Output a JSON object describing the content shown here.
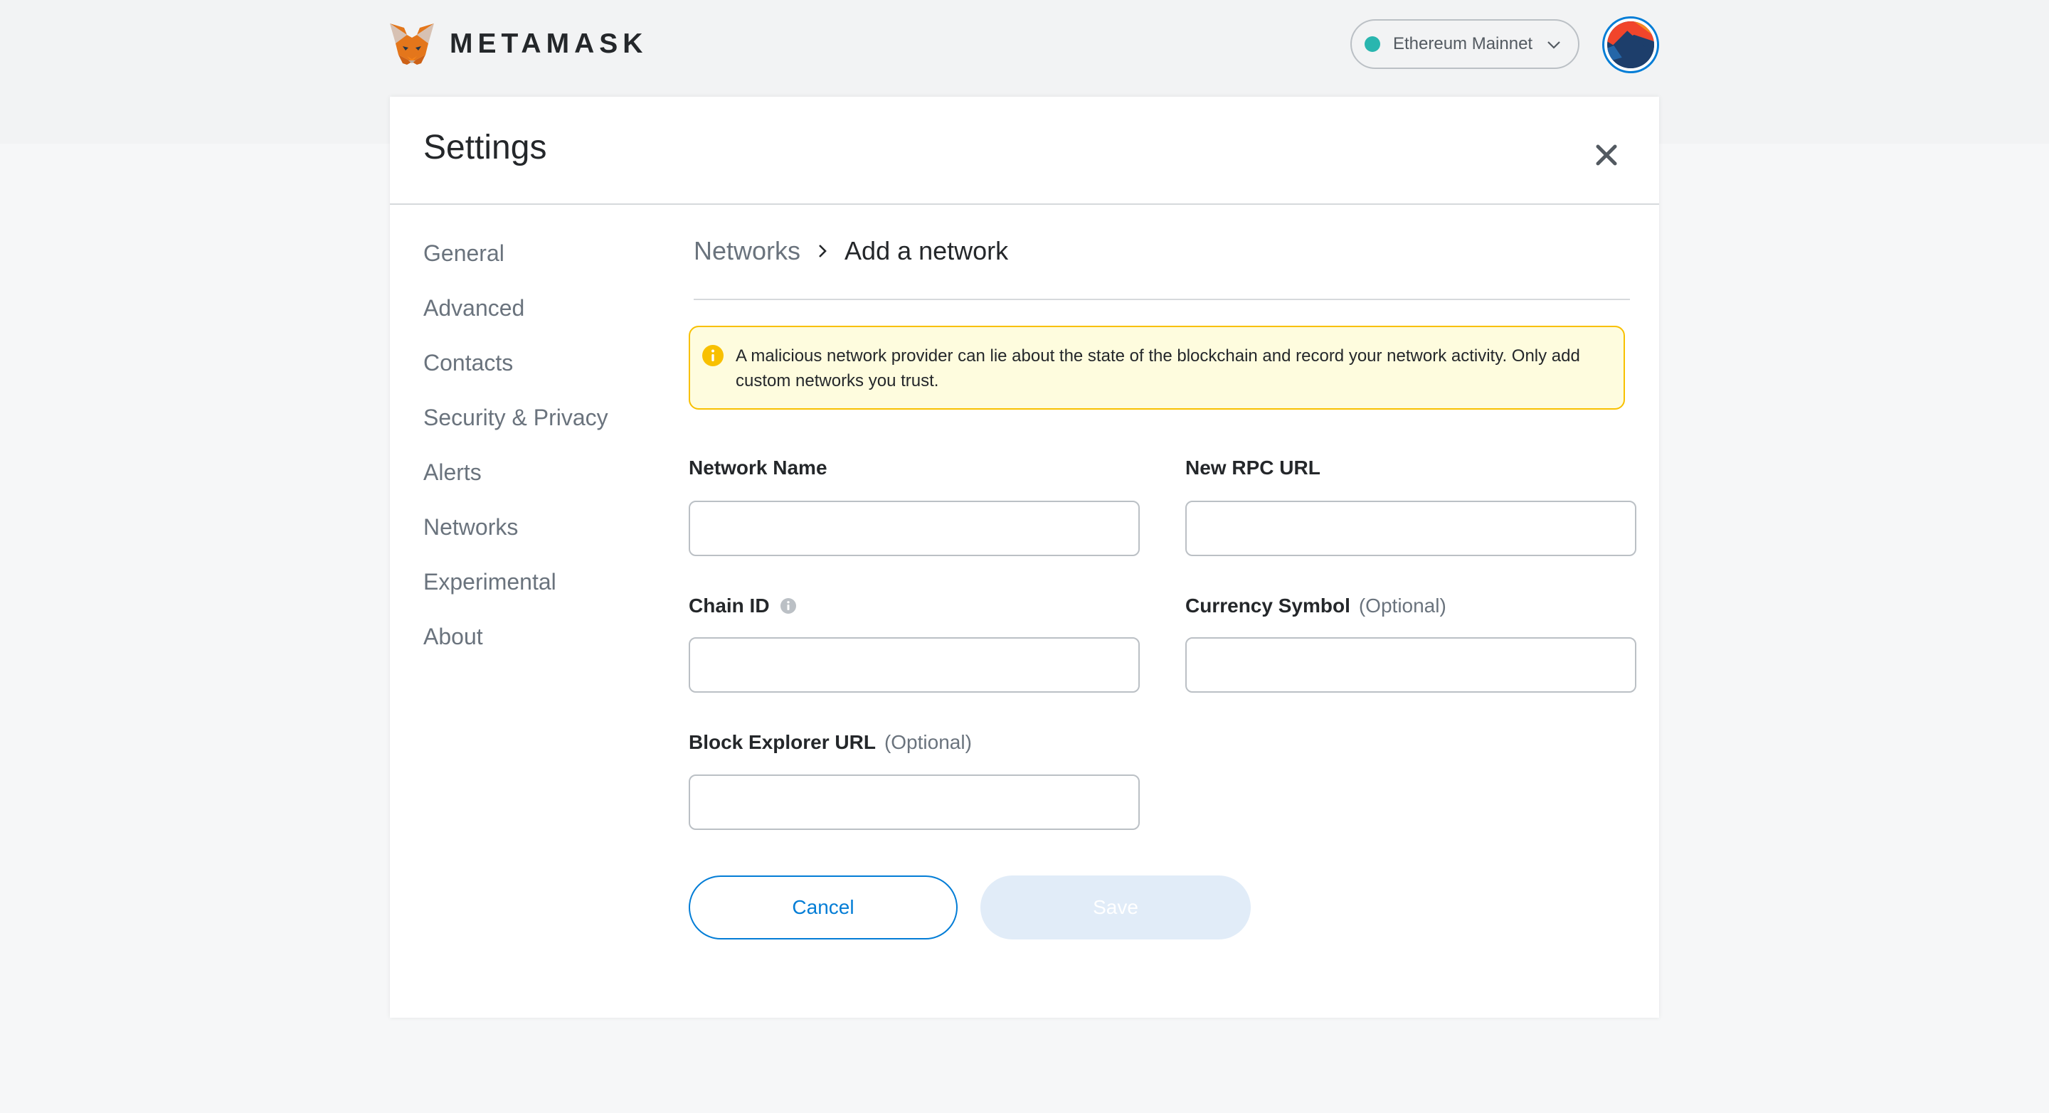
{
  "header": {
    "brand": "METAMASK",
    "network": {
      "label": "Ethereum Mainnet",
      "dot_color": "#29b6af"
    }
  },
  "settings": {
    "title": "Settings",
    "sidebar": [
      {
        "label": "General"
      },
      {
        "label": "Advanced"
      },
      {
        "label": "Contacts"
      },
      {
        "label": "Security & Privacy"
      },
      {
        "label": "Alerts"
      },
      {
        "label": "Networks"
      },
      {
        "label": "Experimental"
      },
      {
        "label": "About"
      }
    ],
    "breadcrumb": {
      "parent": "Networks",
      "current": "Add a network"
    },
    "warning": "A malicious network provider can lie about the state of the blockchain and record your network activity. Only add custom networks you trust.",
    "fields": {
      "network_name": {
        "label": "Network Name",
        "value": ""
      },
      "rpc_url": {
        "label": "New RPC URL",
        "value": ""
      },
      "chain_id": {
        "label": "Chain ID",
        "value": ""
      },
      "currency_symbol": {
        "label": "Currency Symbol",
        "optional": "(Optional)",
        "value": ""
      },
      "block_explorer": {
        "label": "Block Explorer URL",
        "optional": "(Optional)",
        "value": ""
      }
    },
    "buttons": {
      "cancel": "Cancel",
      "save": "Save"
    }
  },
  "colors": {
    "accent": "#037dd6",
    "warning_border": "#f8c000",
    "warning_bg": "#fefcde",
    "save_disabled_bg": "#e1ecf8"
  }
}
